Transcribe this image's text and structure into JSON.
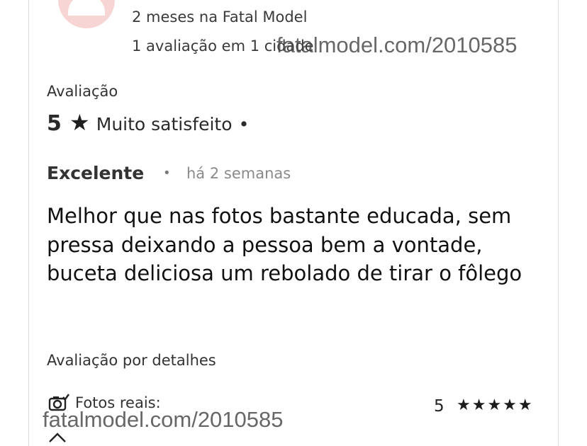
{
  "reviewer": {
    "member_since": "2 meses na Fatal Model",
    "review_count": "1 avaliação em 1 cidade"
  },
  "watermark_text": "fatalmodel.com/2010585",
  "rating": {
    "heading": "Avaliação",
    "score": "5",
    "star": "★",
    "label": "Muito satisfeito",
    "separator": "•"
  },
  "review": {
    "title": "Excelente",
    "separator": "•",
    "time_ago": "há 2 semanas",
    "body": "Melhor que nas fotos bastante educada, sem pressa deixando a pessoa bem a vontade, buceta deliciosa um rebolado de tirar o fôlego"
  },
  "details": {
    "heading": "Avaliação por detalhes",
    "items": [
      {
        "icon": "camera-check-icon",
        "label": "Fotos reais:",
        "score": "5",
        "stars": "★★★★★"
      }
    ]
  }
}
